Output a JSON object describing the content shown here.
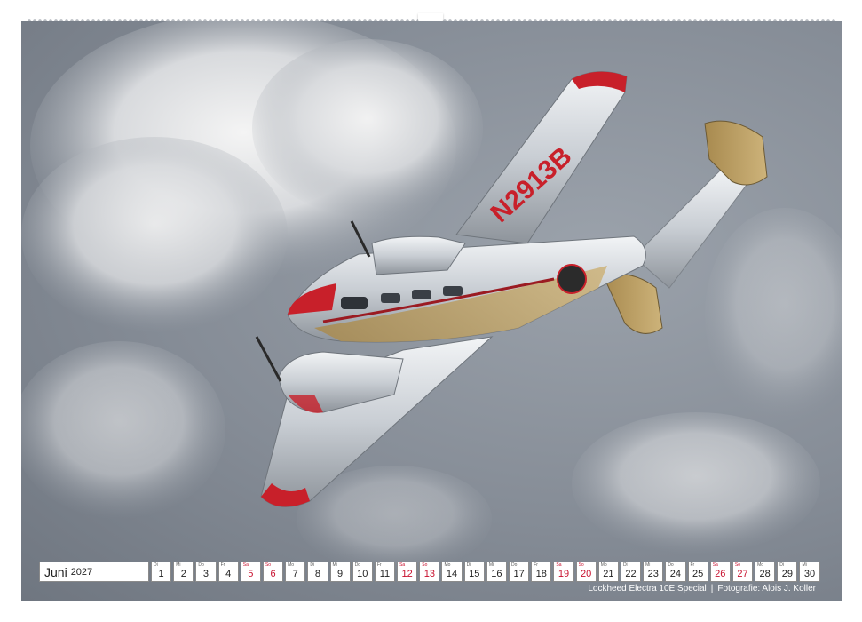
{
  "calendar": {
    "month": "Juni",
    "year": "2027",
    "days": [
      {
        "wd": "Di",
        "n": "1",
        "weekend": false
      },
      {
        "wd": "Mi",
        "n": "2",
        "weekend": false
      },
      {
        "wd": "Do",
        "n": "3",
        "weekend": false
      },
      {
        "wd": "Fr",
        "n": "4",
        "weekend": false
      },
      {
        "wd": "Sa",
        "n": "5",
        "weekend": true
      },
      {
        "wd": "So",
        "n": "6",
        "weekend": true
      },
      {
        "wd": "Mo",
        "n": "7",
        "weekend": false
      },
      {
        "wd": "Di",
        "n": "8",
        "weekend": false
      },
      {
        "wd": "Mi",
        "n": "9",
        "weekend": false
      },
      {
        "wd": "Do",
        "n": "10",
        "weekend": false
      },
      {
        "wd": "Fr",
        "n": "11",
        "weekend": false
      },
      {
        "wd": "Sa",
        "n": "12",
        "weekend": true
      },
      {
        "wd": "So",
        "n": "13",
        "weekend": true
      },
      {
        "wd": "Mo",
        "n": "14",
        "weekend": false
      },
      {
        "wd": "Di",
        "n": "15",
        "weekend": false
      },
      {
        "wd": "Mi",
        "n": "16",
        "weekend": false
      },
      {
        "wd": "Do",
        "n": "17",
        "weekend": false
      },
      {
        "wd": "Fr",
        "n": "18",
        "weekend": false
      },
      {
        "wd": "Sa",
        "n": "19",
        "weekend": true
      },
      {
        "wd": "So",
        "n": "20",
        "weekend": true
      },
      {
        "wd": "Mo",
        "n": "21",
        "weekend": false
      },
      {
        "wd": "Di",
        "n": "22",
        "weekend": false
      },
      {
        "wd": "Mi",
        "n": "23",
        "weekend": false
      },
      {
        "wd": "Do",
        "n": "24",
        "weekend": false
      },
      {
        "wd": "Fr",
        "n": "25",
        "weekend": false
      },
      {
        "wd": "Sa",
        "n": "26",
        "weekend": true
      },
      {
        "wd": "So",
        "n": "27",
        "weekend": true
      },
      {
        "wd": "Mo",
        "n": "28",
        "weekend": false
      },
      {
        "wd": "Di",
        "n": "29",
        "weekend": false
      },
      {
        "wd": "Mi",
        "n": "30",
        "weekend": false
      }
    ]
  },
  "photo": {
    "registration": "N2913B",
    "caption_title": "Lockheed Electra 10E Special",
    "caption_separator": "|",
    "caption_credit": "Fotografie: Alois J. Koller"
  },
  "colors": {
    "weekend": "#c8102e",
    "sky": "#858c96",
    "aircraft_red": "#c8202a",
    "aircraft_silver": "#d9dde2",
    "aircraft_gold": "#b89a5c"
  }
}
